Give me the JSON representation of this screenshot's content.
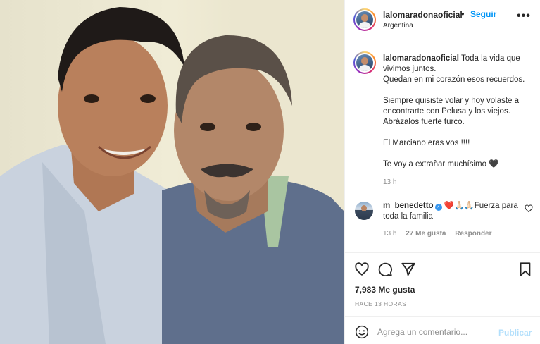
{
  "post": {
    "photo_icon": "photo-two-men-smiling",
    "header": {
      "username": "lalomaradonaoficial",
      "separator": "•",
      "follow_label": "Seguir",
      "location": "Argentina",
      "more_icon": "more-horizontal-icon",
      "more_label": "•••"
    },
    "caption": {
      "username": "lalomaradonaoficial",
      "lines": [
        "Toda la vida que vivimos juntos.",
        "Quedan en mi corazón esos recuerdos.",
        "",
        "Siempre quisiste volar y hoy volaste a encontrarte con Pelusa y los viejos. Abrázalos fuerte turco.",
        "",
        "El Marciano eras vos !!!!",
        "",
        "Te voy a extrañar muchísimo 🖤"
      ],
      "time": "13 h"
    },
    "comments": [
      {
        "username": "m_benedetto",
        "verified": true,
        "text": "❤️🙏🏻🙏🏻Fuerza para toda la familia",
        "time": "13 h",
        "likes": "27 Me gusta",
        "reply_label": "Responder"
      }
    ],
    "actions": {
      "like_icon": "heart-icon",
      "comment_icon": "comment-icon",
      "share_icon": "send-icon",
      "save_icon": "bookmark-icon"
    },
    "likes_count": "7,983 Me gusta",
    "posted_ago": "HACE 13 HORAS",
    "add_comment": {
      "placeholder": "Agrega un comentario...",
      "publish_label": "Publicar",
      "emoji_icon": "emoji-icon"
    }
  },
  "colors": {
    "link_blue": "#0095f6",
    "publish_disabled": "#b2dffc",
    "text": "#262626",
    "muted": "#8e8e8e",
    "divider": "#efefef"
  }
}
